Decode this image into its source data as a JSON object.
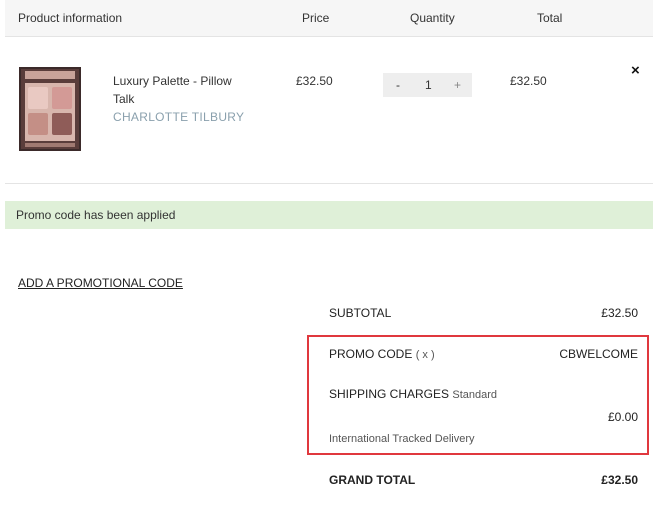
{
  "header": {
    "product": "Product information",
    "price": "Price",
    "quantity": "Quantity",
    "total": "Total"
  },
  "item": {
    "name": "Luxury Palette - Pillow Talk",
    "brand": "CHARLOTTE TILBURY",
    "price": "£32.50",
    "qty_minus": "-",
    "qty_value": "1",
    "qty_plus": "+",
    "total": "£32.50",
    "remove": "×",
    "thumb_icon": "eyeshadow-palette-image"
  },
  "alert": {
    "message": "Promo code has been applied",
    "color": "#dff0d8"
  },
  "promo_link": "ADD A PROMOTIONAL CODE",
  "summary": {
    "subtotal_label": "SUBTOTAL",
    "subtotal_value": "£32.50",
    "promo_label": "PROMO CODE",
    "promo_remove": "( x )",
    "promo_value": "CBWELCOME",
    "shipping_label": "SHIPPING CHARGES",
    "shipping_method": "Standard",
    "shipping_value": "£0.00",
    "shipping_note": "International Tracked Delivery",
    "grand_label": "GRAND TOTAL",
    "grand_value": "£32.50",
    "highlight_color": "#e0383e"
  }
}
